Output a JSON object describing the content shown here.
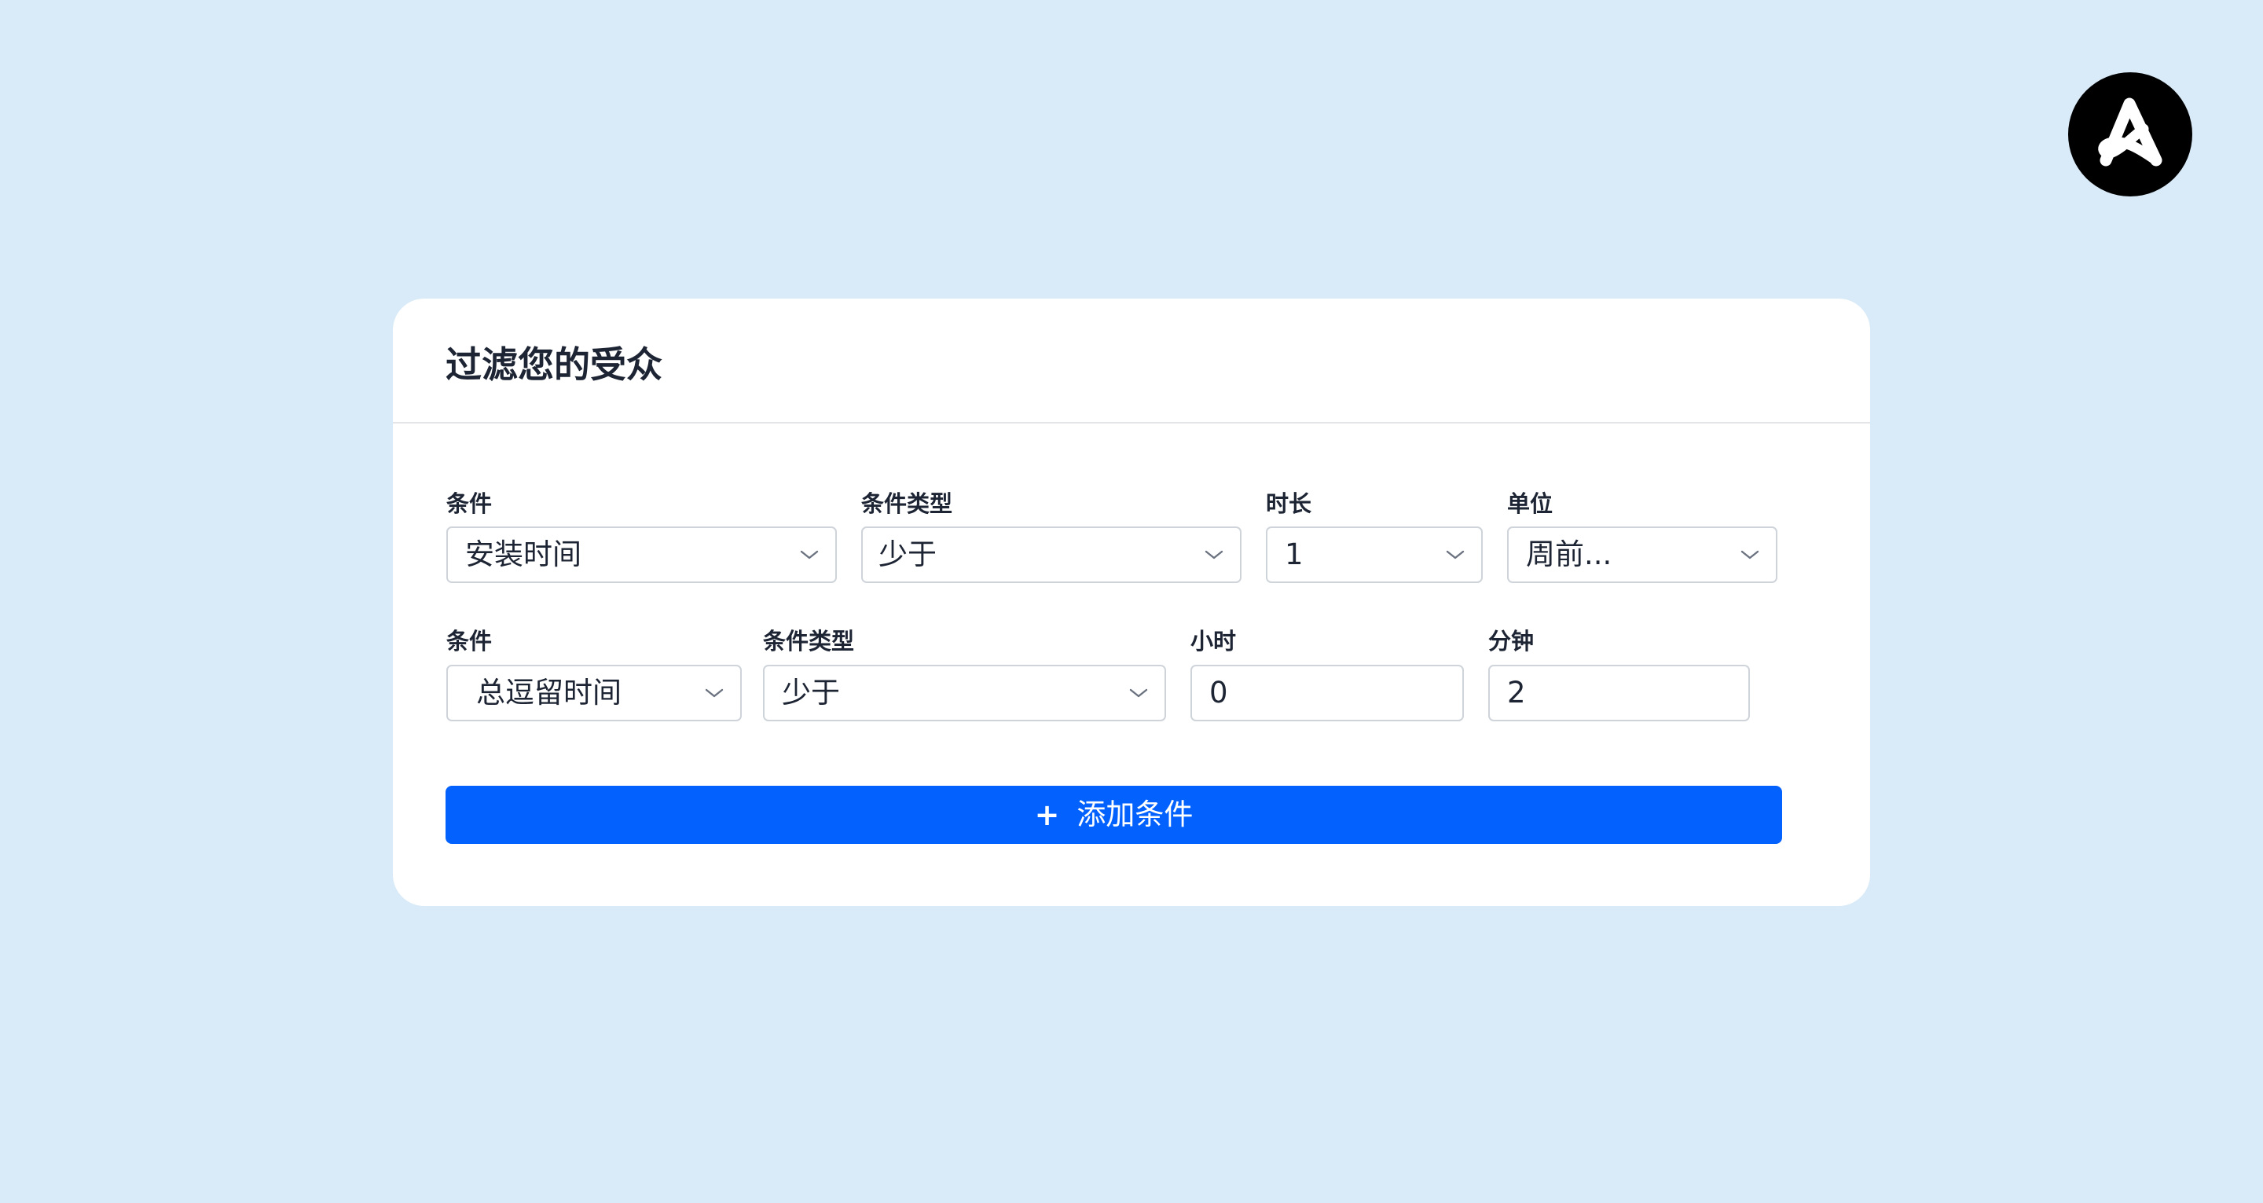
{
  "brand": {
    "logo_icon": "brand-a-logo-icon",
    "logo_background": "#000000",
    "logo_foreground": "#ffffff"
  },
  "colors": {
    "background": "#d9ebf8",
    "card": "#ffffff",
    "accent": "#0362fe",
    "text": "#1d2433",
    "border": "#cfd4da"
  },
  "filter": {
    "title": "过滤您的受众",
    "rows": [
      {
        "fields": [
          {
            "label": "条件",
            "value": "安装时间",
            "type": "select"
          },
          {
            "label": "条件类型",
            "value": "少于",
            "type": "select"
          },
          {
            "label": "时长",
            "value": "1",
            "type": "select"
          },
          {
            "label": "单位",
            "value": "周前...",
            "type": "select"
          }
        ]
      },
      {
        "fields": [
          {
            "label": "条件",
            "value": "总逗留时间",
            "type": "select"
          },
          {
            "label": "条件类型",
            "value": "少于",
            "type": "select"
          },
          {
            "label": "小时",
            "value": "0",
            "type": "input"
          },
          {
            "label": "分钟",
            "value": "2",
            "type": "input"
          }
        ]
      }
    ],
    "add_button": {
      "icon": "plus-icon",
      "icon_glyph": "+",
      "label": "添加条件"
    },
    "dropdown_icon": "chevron-down-icon"
  }
}
